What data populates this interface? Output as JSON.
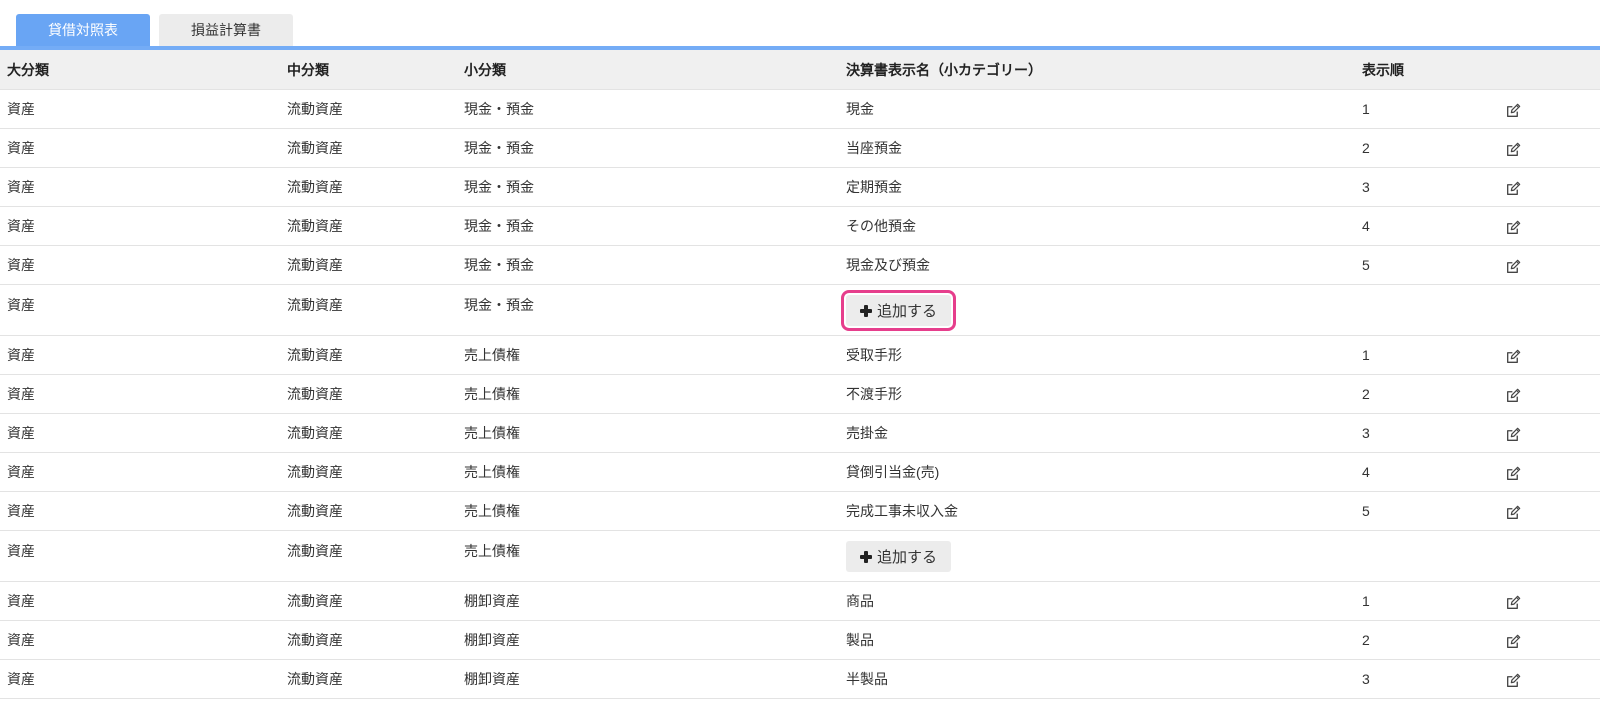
{
  "tabs": [
    {
      "label": "貸借対照表",
      "active": true
    },
    {
      "label": "損益計算書",
      "active": false
    }
  ],
  "table": {
    "headers": {
      "major": "大分類",
      "middle": "中分類",
      "minor": "小分類",
      "display_name": "決算書表示名（小カテゴリー）",
      "order": "表示順"
    },
    "icons": {
      "row_action": "edit-icon",
      "add": "plus-icon"
    },
    "rows": [
      {
        "major": "資産",
        "middle": "流動資産",
        "minor": "現金・預金",
        "display_name": "現金",
        "order": 1
      },
      {
        "major": "資産",
        "middle": "流動資産",
        "minor": "現金・預金",
        "display_name": "当座預金",
        "order": 2
      },
      {
        "major": "資産",
        "middle": "流動資産",
        "minor": "現金・預金",
        "display_name": "定期預金",
        "order": 3
      },
      {
        "major": "資産",
        "middle": "流動資産",
        "minor": "現金・預金",
        "display_name": "その他預金",
        "order": 4
      },
      {
        "major": "資産",
        "middle": "流動資産",
        "minor": "現金・預金",
        "display_name": "現金及び預金",
        "order": 5
      },
      {
        "major": "資産",
        "middle": "流動資産",
        "minor": "現金・預金",
        "add_label": "追加する",
        "highlighted": true
      },
      {
        "major": "資産",
        "middle": "流動資産",
        "minor": "売上債権",
        "display_name": "受取手形",
        "order": 1
      },
      {
        "major": "資産",
        "middle": "流動資産",
        "minor": "売上債権",
        "display_name": "不渡手形",
        "order": 2
      },
      {
        "major": "資産",
        "middle": "流動資産",
        "minor": "売上債権",
        "display_name": "売掛金",
        "order": 3
      },
      {
        "major": "資産",
        "middle": "流動資産",
        "minor": "売上債権",
        "display_name": "貸倒引当金(売)",
        "order": 4
      },
      {
        "major": "資産",
        "middle": "流動資産",
        "minor": "売上債権",
        "display_name": "完成工事未収入金",
        "order": 5
      },
      {
        "major": "資産",
        "middle": "流動資産",
        "minor": "売上債権",
        "add_label": "追加する",
        "highlighted": false
      },
      {
        "major": "資産",
        "middle": "流動資産",
        "minor": "棚卸資産",
        "display_name": "商品",
        "order": 1
      },
      {
        "major": "資産",
        "middle": "流動資産",
        "minor": "棚卸資産",
        "display_name": "製品",
        "order": 2
      },
      {
        "major": "資産",
        "middle": "流動資産",
        "minor": "棚卸資産",
        "display_name": "半製品",
        "order": 3
      }
    ]
  },
  "colors": {
    "tab_active": "#69a5f4",
    "tab_inactive": "#ececec",
    "accent_line": "#74acf6",
    "header_bg": "#f0f0f0",
    "row_border": "#e3e3e3",
    "highlight": "#e63e8c",
    "add_button_bg": "#ececec"
  }
}
